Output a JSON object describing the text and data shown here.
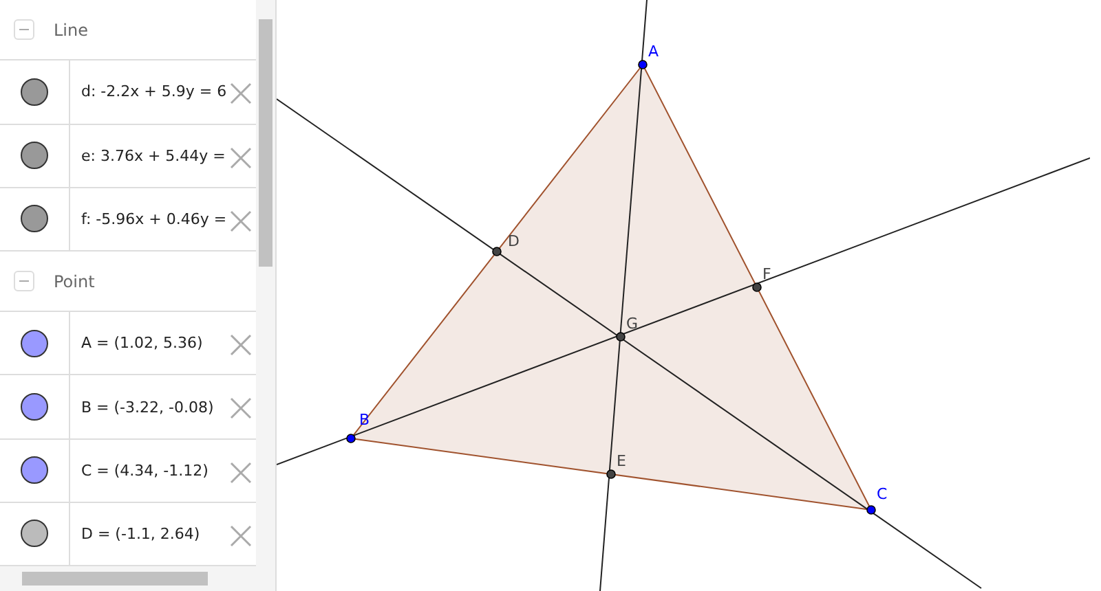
{
  "algebra": {
    "groups": [
      {
        "title": "Line",
        "expanded": true,
        "items": [
          {
            "text": "d: -2.2x + 5.9y = 6",
            "color": "#999999"
          },
          {
            "text": "e: 3.76x + 5.44y =",
            "color": "#999999"
          },
          {
            "text": "f: -5.96x + 0.46y =",
            "color": "#999999"
          }
        ]
      },
      {
        "title": "Point",
        "expanded": true,
        "items": [
          {
            "text": "A = (1.02, 5.36)",
            "color": "#9999ff"
          },
          {
            "text": "B = (-3.22, -0.08)",
            "color": "#9999ff"
          },
          {
            "text": "C = (4.34, -1.12)",
            "color": "#9999ff"
          },
          {
            "text": "D = (-1.1, 2.64)",
            "color": "#bbbbbb"
          }
        ]
      }
    ]
  },
  "canvas": {
    "points": [
      {
        "label": "A",
        "free": true
      },
      {
        "label": "B",
        "free": true
      },
      {
        "label": "C",
        "free": true
      },
      {
        "label": "D",
        "free": false
      },
      {
        "label": "E",
        "free": false
      },
      {
        "label": "F",
        "free": false
      },
      {
        "label": "G",
        "free": false
      }
    ]
  }
}
